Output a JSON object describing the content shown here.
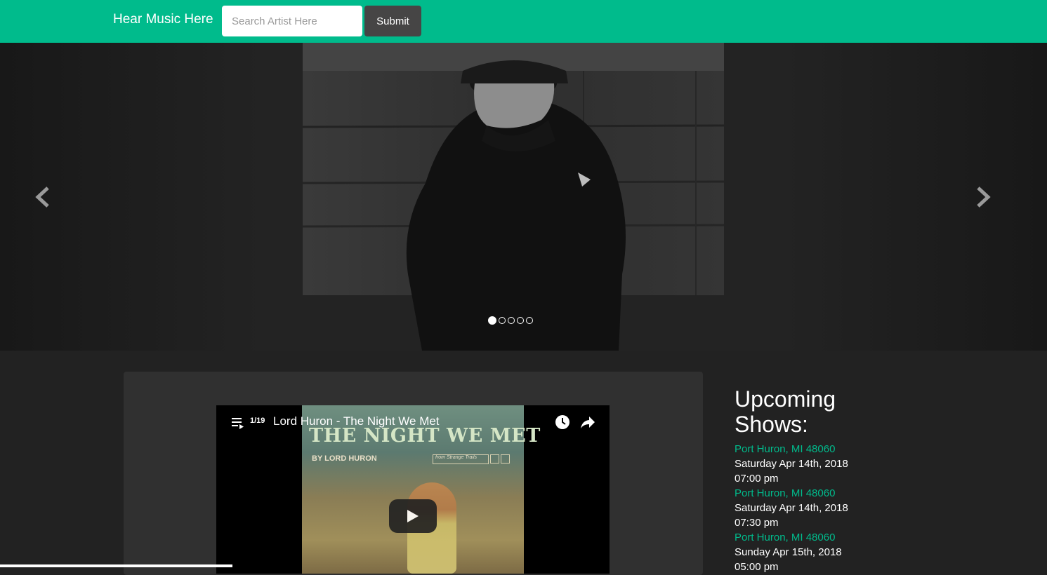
{
  "navbar": {
    "brand": "Hear Music Here",
    "search_placeholder": "Search Artist Here",
    "search_value": "",
    "submit_label": "Submit"
  },
  "carousel": {
    "slide_count": 5,
    "active_index": 0,
    "prev_icon": "chevron-left-icon",
    "next_icon": "chevron-right-icon"
  },
  "video": {
    "playlist_position": "1/19",
    "title": "Lord Huron - The Night We Met",
    "thumbnail": {
      "title": "THE NIGHT WE MET",
      "byline": "BY LORD HURON",
      "label": "from Strange Trails"
    },
    "icons": [
      "playlist-icon",
      "clock-icon",
      "share-icon",
      "play-icon"
    ]
  },
  "shows": {
    "heading": "Upcoming Shows:",
    "items": [
      {
        "location": "Port Huron, MI 48060",
        "date": "Saturday Apr 14th, 2018 07:00 pm"
      },
      {
        "location": "Port Huron, MI 48060",
        "date": "Saturday Apr 14th, 2018 07:30 pm"
      },
      {
        "location": "Port Huron, MI 48060",
        "date": "Sunday Apr 15th, 2018 05:00 pm"
      }
    ]
  },
  "colors": {
    "accent": "#00bb8c",
    "background": "#222222",
    "panel": "#303030",
    "button": "#464545"
  }
}
